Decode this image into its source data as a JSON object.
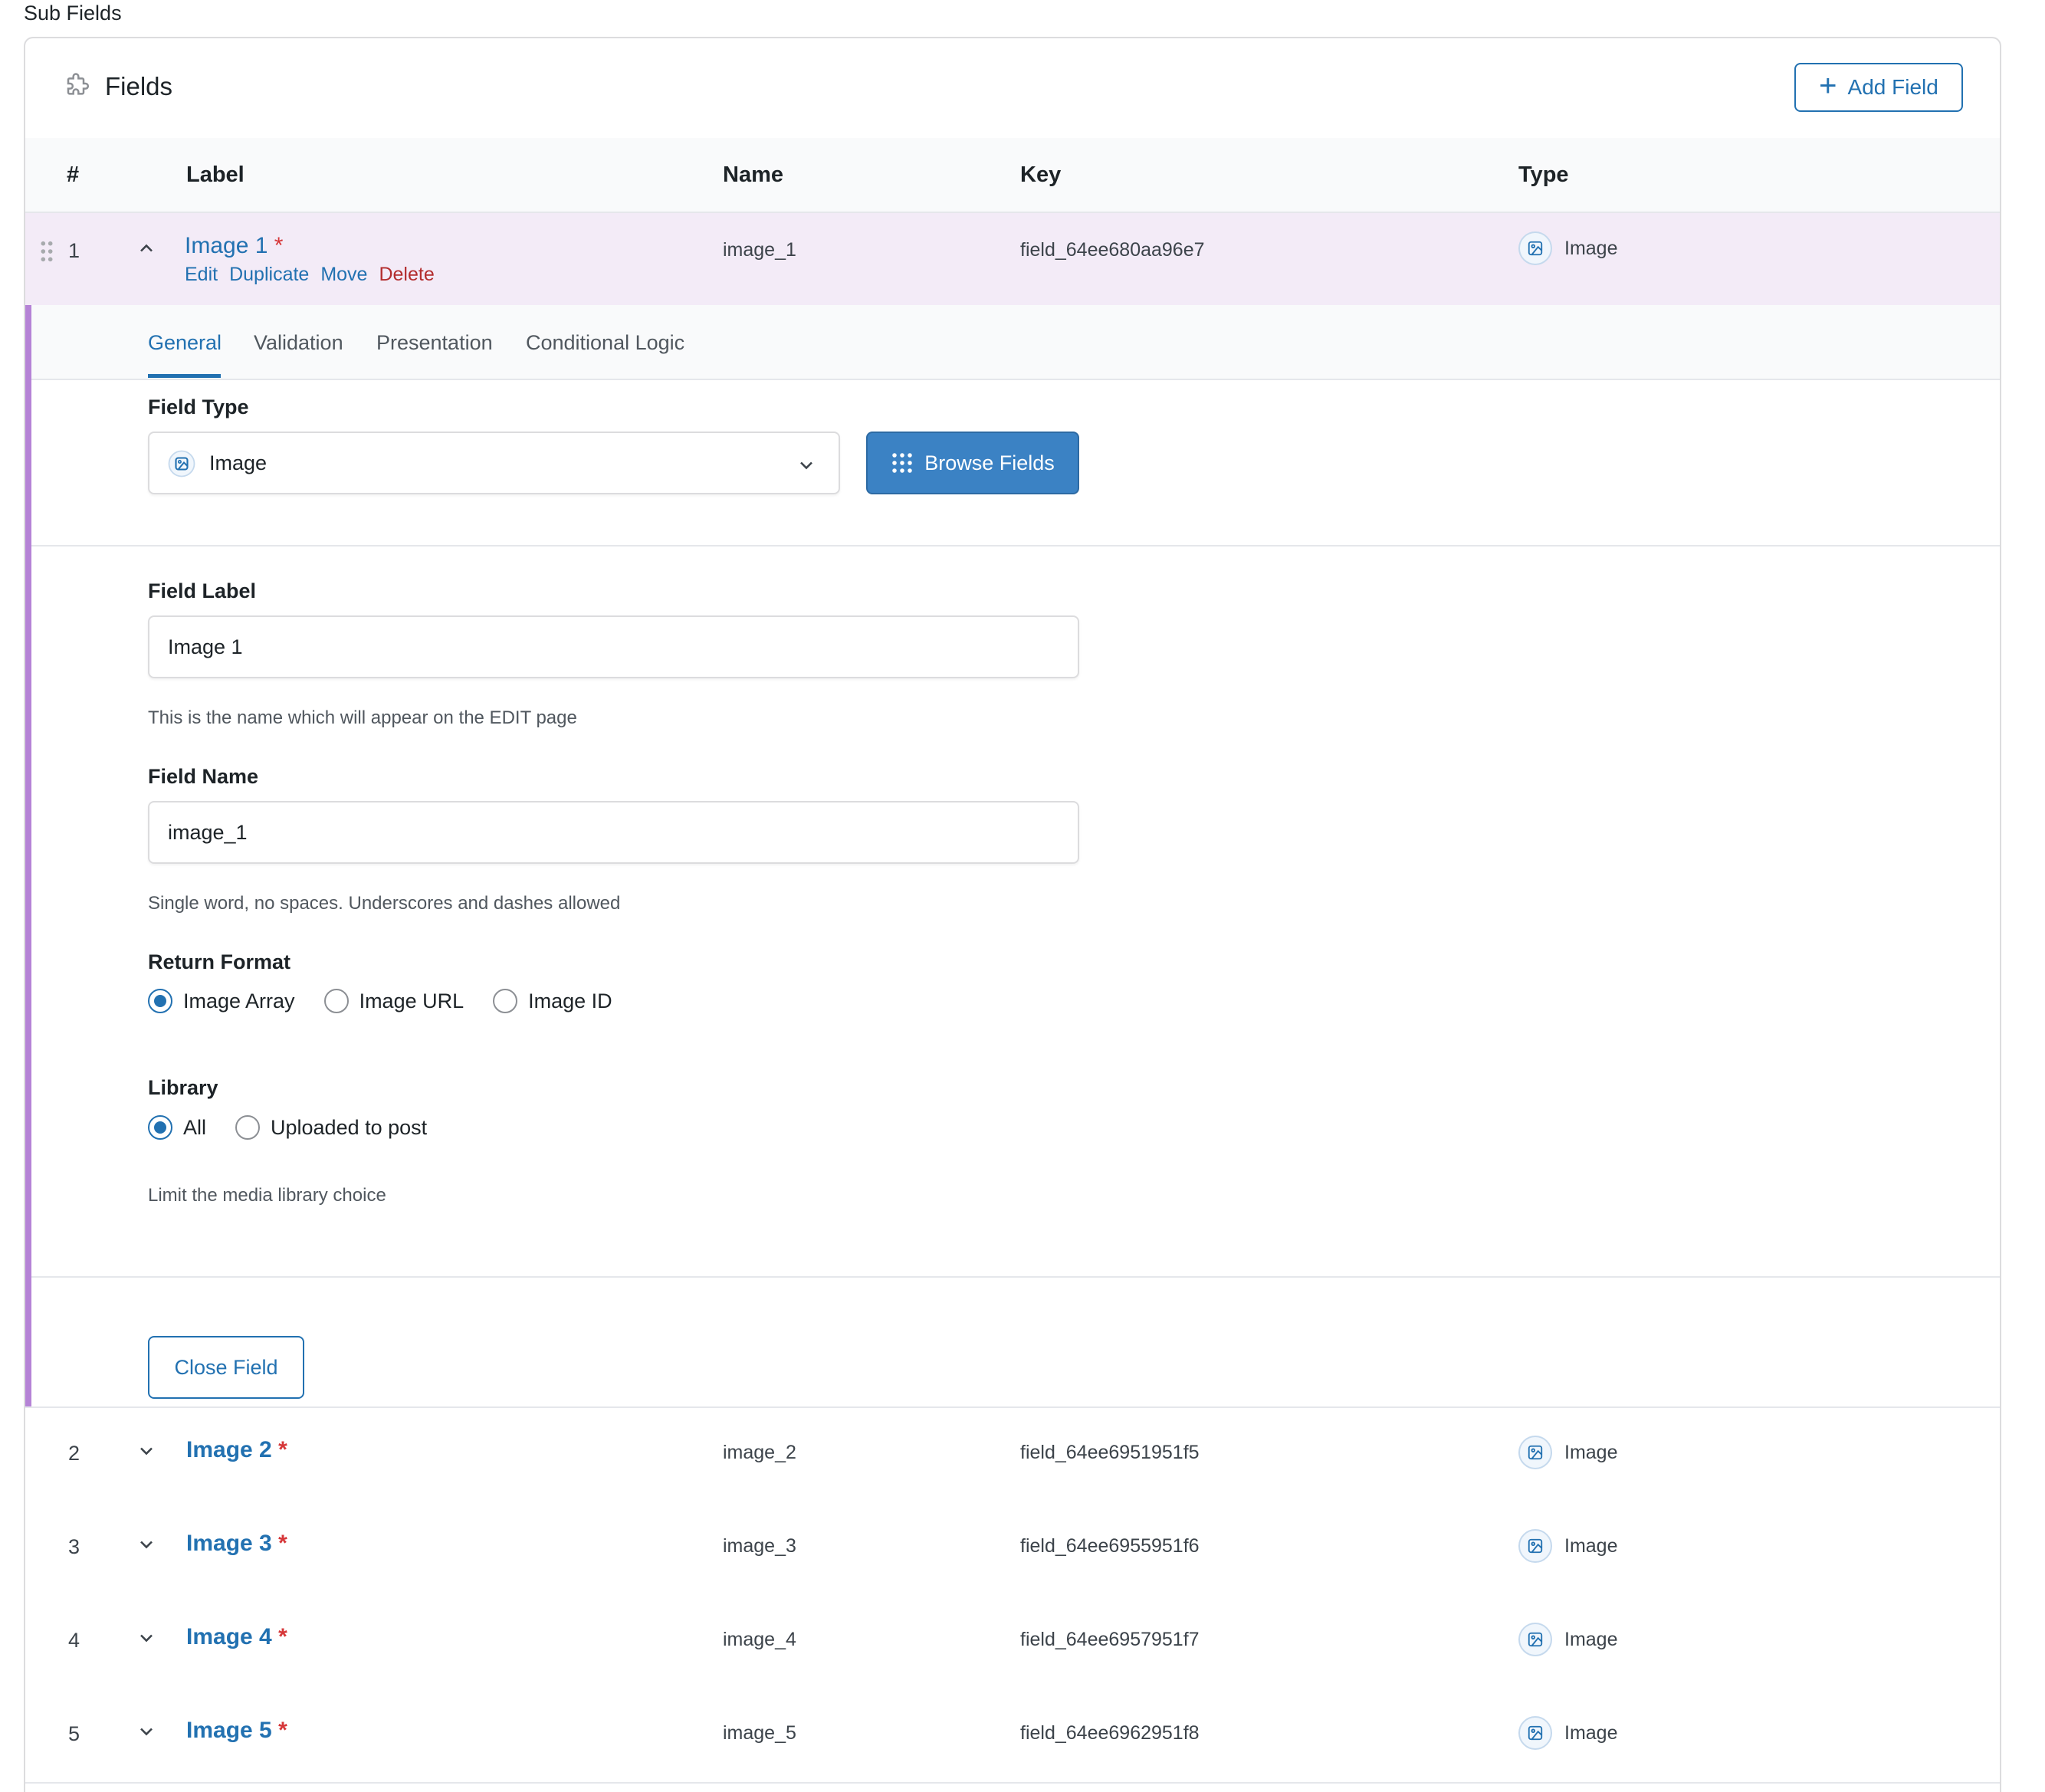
{
  "section_title": "Sub Fields",
  "panel": {
    "title": "Fields",
    "add_button": "Add Field"
  },
  "columns": {
    "num": "#",
    "label": "Label",
    "name": "Name",
    "key": "Key",
    "type": "Type"
  },
  "fields": [
    {
      "num": "1",
      "label": "Image 1",
      "required": "*",
      "name": "image_1",
      "key": "field_64ee680aa96e7",
      "type": "Image"
    },
    {
      "num": "2",
      "label": "Image 2",
      "required": "*",
      "name": "image_2",
      "key": "field_64ee6951951f5",
      "type": "Image"
    },
    {
      "num": "3",
      "label": "Image 3",
      "required": "*",
      "name": "image_3",
      "key": "field_64ee6955951f6",
      "type": "Image"
    },
    {
      "num": "4",
      "label": "Image 4",
      "required": "*",
      "name": "image_4",
      "key": "field_64ee6957951f7",
      "type": "Image"
    },
    {
      "num": "5",
      "label": "Image 5",
      "required": "*",
      "name": "image_5",
      "key": "field_64ee6962951f8",
      "type": "Image"
    }
  ],
  "row_actions": {
    "edit": "Edit",
    "duplicate": "Duplicate",
    "move": "Move",
    "delete": "Delete"
  },
  "tabs": [
    "General",
    "Validation",
    "Presentation",
    "Conditional Logic"
  ],
  "active_tab": "General",
  "settings": {
    "field_type": {
      "label": "Field Type",
      "value": "Image",
      "browse_button": "Browse Fields"
    },
    "field_label": {
      "label": "Field Label",
      "value": "Image 1",
      "help": "This is the name which will appear on the EDIT page"
    },
    "field_name": {
      "label": "Field Name",
      "value": "image_1",
      "help": "Single word, no spaces. Underscores and dashes allowed"
    },
    "return_format": {
      "label": "Return Format",
      "options": [
        "Image Array",
        "Image URL",
        "Image ID"
      ],
      "selected": "Image Array"
    },
    "library": {
      "label": "Library",
      "options": [
        "All",
        "Uploaded to post"
      ],
      "selected": "All",
      "help": "Limit the media library choice"
    },
    "close_button": "Close Field"
  },
  "colors": {
    "accent": "#2271b1",
    "delete": "#b32d2e",
    "required": "#d63638",
    "expanded_row_bg": "#f3ebf7",
    "expanded_border": "#b583d6"
  },
  "icons": {
    "panel": "puzzle-icon",
    "add": "plus-icon",
    "drag": "drag-handle-icon",
    "expand": "chevron-up-icon",
    "collapse": "chevron-down-icon",
    "type": "image-icon",
    "browse": "grid-icon"
  }
}
